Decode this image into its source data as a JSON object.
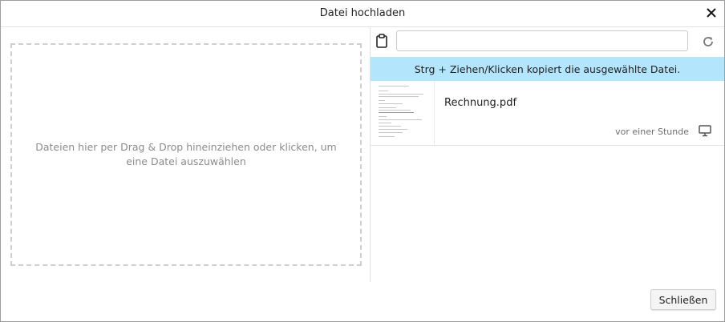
{
  "dialog": {
    "title": "Datei hochladen",
    "close_icon": "close-icon"
  },
  "dropzone": {
    "text": "Dateien hier per Drag & Drop hineinziehen oder klicken, um eine Datei auszuwählen"
  },
  "panel": {
    "clipboard_icon": "clipboard-icon",
    "search_value": "",
    "refresh_icon": "refresh-icon",
    "info": "Strg + Ziehen/Klicken kopiert die ausgewählte Datei.",
    "info_color": "#b3e5fc"
  },
  "files": [
    {
      "name": "Rechnung.pdf",
      "time": "vor einer Stunde",
      "thumbnail_icon": "pdf-thumbnail",
      "source_icon": "monitor-icon"
    }
  ],
  "footer": {
    "close_label": "Schließen"
  }
}
